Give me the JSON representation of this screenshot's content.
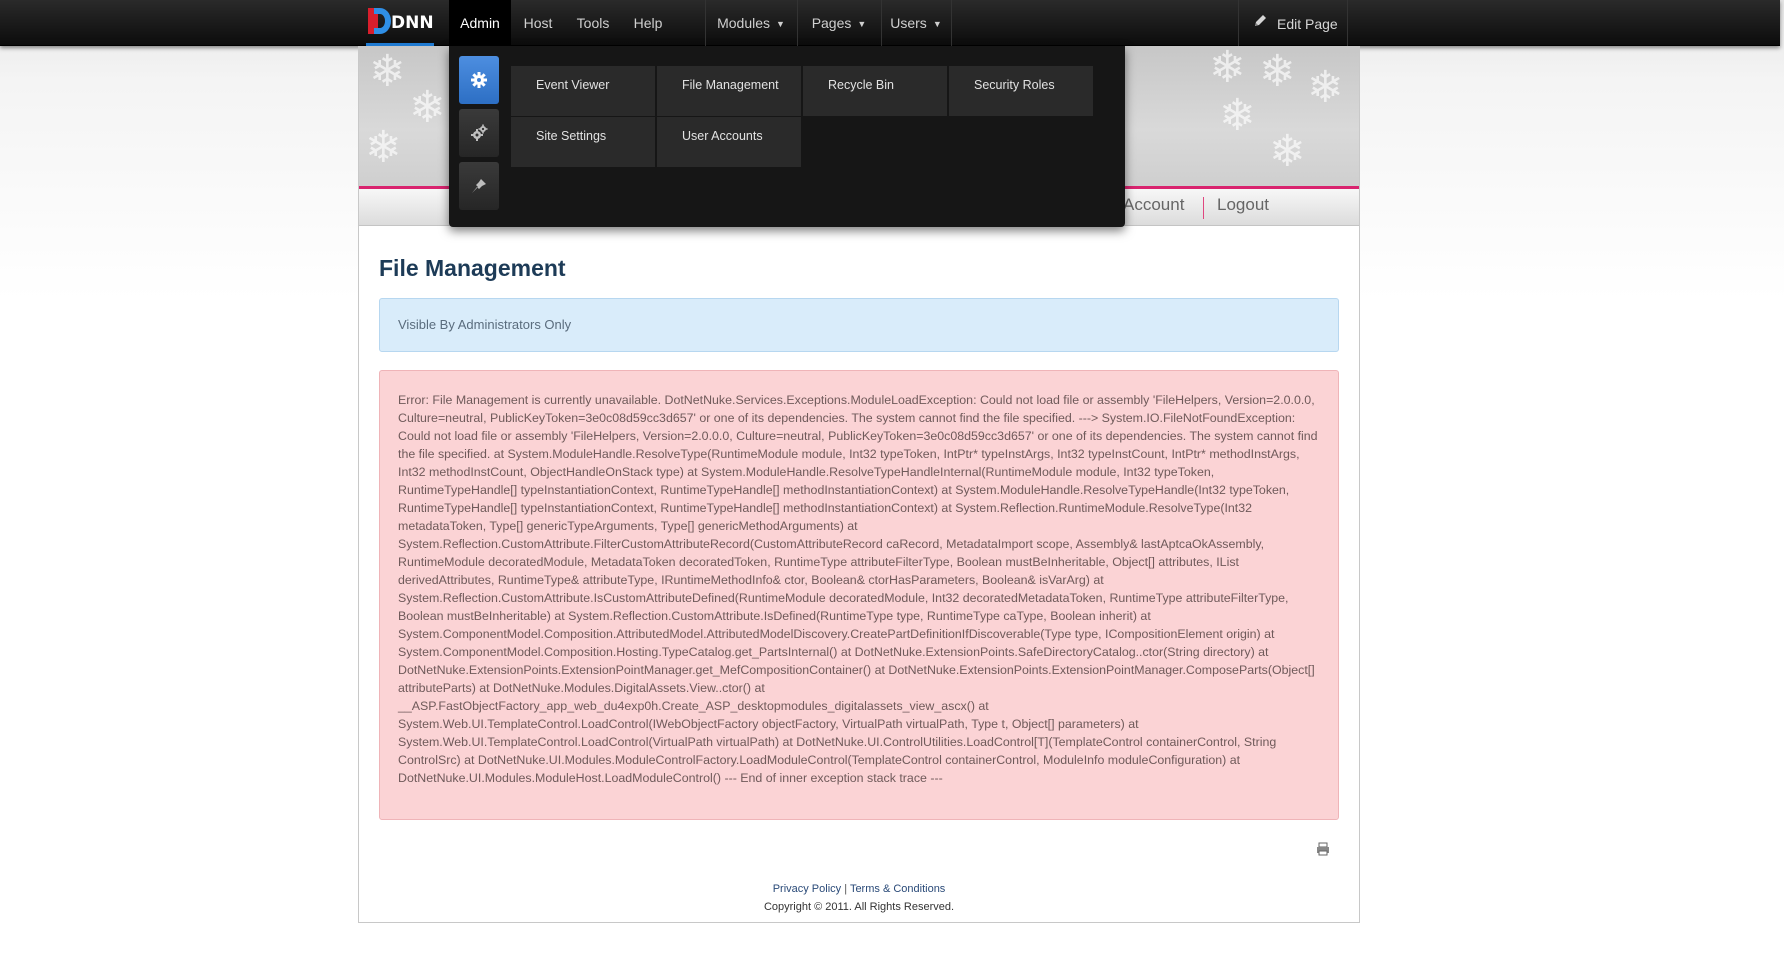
{
  "topbar": {
    "logo_text": "DNN",
    "nav": [
      {
        "label": "Admin"
      },
      {
        "label": "Host"
      },
      {
        "label": "Tools"
      },
      {
        "label": "Help"
      },
      {
        "label": "Modules"
      },
      {
        "label": "Pages"
      },
      {
        "label": "Users"
      }
    ],
    "edit_page": "Edit Page"
  },
  "admin_menu": {
    "category_icons": [
      "gear-icon",
      "gears-icon",
      "pin-icon"
    ],
    "items": [
      {
        "label": "Event Viewer"
      },
      {
        "label": "File Management"
      },
      {
        "label": "Recycle Bin"
      },
      {
        "label": "Security Roles"
      },
      {
        "label": "Site Settings"
      },
      {
        "label": "User Accounts"
      }
    ]
  },
  "skin": {
    "user_links": [
      {
        "label": "Account"
      },
      {
        "label": "Logout"
      }
    ],
    "page_title": "File Management",
    "visibility_notice": "Visible By Administrators Only",
    "error_message": "Error: File Management is currently unavailable. DotNetNuke.Services.Exceptions.ModuleLoadException: Could not load file or assembly 'FileHelpers, Version=2.0.0.0, Culture=neutral, PublicKeyToken=3e0c08d59cc3d657' or one of its dependencies. The system cannot find the file specified. ---> System.IO.FileNotFoundException: Could not load file or assembly 'FileHelpers, Version=2.0.0.0, Culture=neutral, PublicKeyToken=3e0c08d59cc3d657' or one of its dependencies. The system cannot find the file specified. at System.ModuleHandle.ResolveType(RuntimeModule module, Int32 typeToken, IntPtr* typeInstArgs, Int32 typeInstCount, IntPtr* methodInstArgs, Int32 methodInstCount, ObjectHandleOnStack type) at System.ModuleHandle.ResolveTypeHandleInternal(RuntimeModule module, Int32 typeToken, RuntimeTypeHandle[] typeInstantiationContext, RuntimeTypeHandle[] methodInstantiationContext) at System.ModuleHandle.ResolveTypeHandle(Int32 typeToken, RuntimeTypeHandle[] typeInstantiationContext, RuntimeTypeHandle[] methodInstantiationContext) at System.Reflection.RuntimeModule.ResolveType(Int32 metadataToken, Type[] genericTypeArguments, Type[] genericMethodArguments) at System.Reflection.CustomAttribute.FilterCustomAttributeRecord(CustomAttributeRecord caRecord, MetadataImport scope, Assembly& lastAptcaOkAssembly, RuntimeModule decoratedModule, MetadataToken decoratedToken, RuntimeType attributeFilterType, Boolean mustBeInheritable, Object[] attributes, IList derivedAttributes, RuntimeType& attributeType, IRuntimeMethodInfo& ctor, Boolean& ctorHasParameters, Boolean& isVarArg) at System.Reflection.CustomAttribute.IsCustomAttributeDefined(RuntimeModule decoratedModule, Int32 decoratedMetadataToken, RuntimeType attributeFilterType, Boolean mustBeInheritable) at System.Reflection.CustomAttribute.IsDefined(RuntimeType type, RuntimeType caType, Boolean inherit) at System.ComponentModel.Composition.AttributedModel.AttributedModelDiscovery.CreatePartDefinitionIfDiscoverable(Type type, ICompositionElement origin) at System.ComponentModel.Composition.Hosting.TypeCatalog.get_PartsInternal() at DotNetNuke.ExtensionPoints.SafeDirectoryCatalog..ctor(String directory) at DotNetNuke.ExtensionPoints.ExtensionPointManager.get_MefCompositionContainer() at DotNetNuke.ExtensionPoints.ExtensionPointManager.ComposeParts(Object[] attributeParts) at DotNetNuke.Modules.DigitalAssets.View..ctor() at __ASP.FastObjectFactory_app_web_du4exp0h.Create_ASP_desktopmodules_digitalassets_view_ascx() at System.Web.UI.TemplateControl.LoadControl(IWebObjectFactory objectFactory, VirtualPath virtualPath, Type t, Object[] parameters) at System.Web.UI.TemplateControl.LoadControl(VirtualPath virtualPath) at DotNetNuke.UI.ControlUtilities.LoadControl[T](TemplateControl containerControl, String ControlSrc) at DotNetNuke.UI.Modules.ModuleControlFactory.LoadModuleControl(TemplateControl containerControl, ModuleInfo moduleConfiguration) at DotNetNuke.UI.Modules.ModuleHost.LoadModuleControl() --- End of inner exception stack trace ---",
    "footer": {
      "privacy": "Privacy Policy",
      "separator": "|",
      "terms": "Terms & Conditions",
      "copyright": "Copyright © 2011. All Rights Reserved."
    }
  },
  "colors": {
    "accent_blue": "#2d6fc4",
    "brand_pink": "#d9246f",
    "error_bg": "#fbd3d5",
    "info_bg": "#d9ecfa",
    "title": "#1d3b57"
  }
}
